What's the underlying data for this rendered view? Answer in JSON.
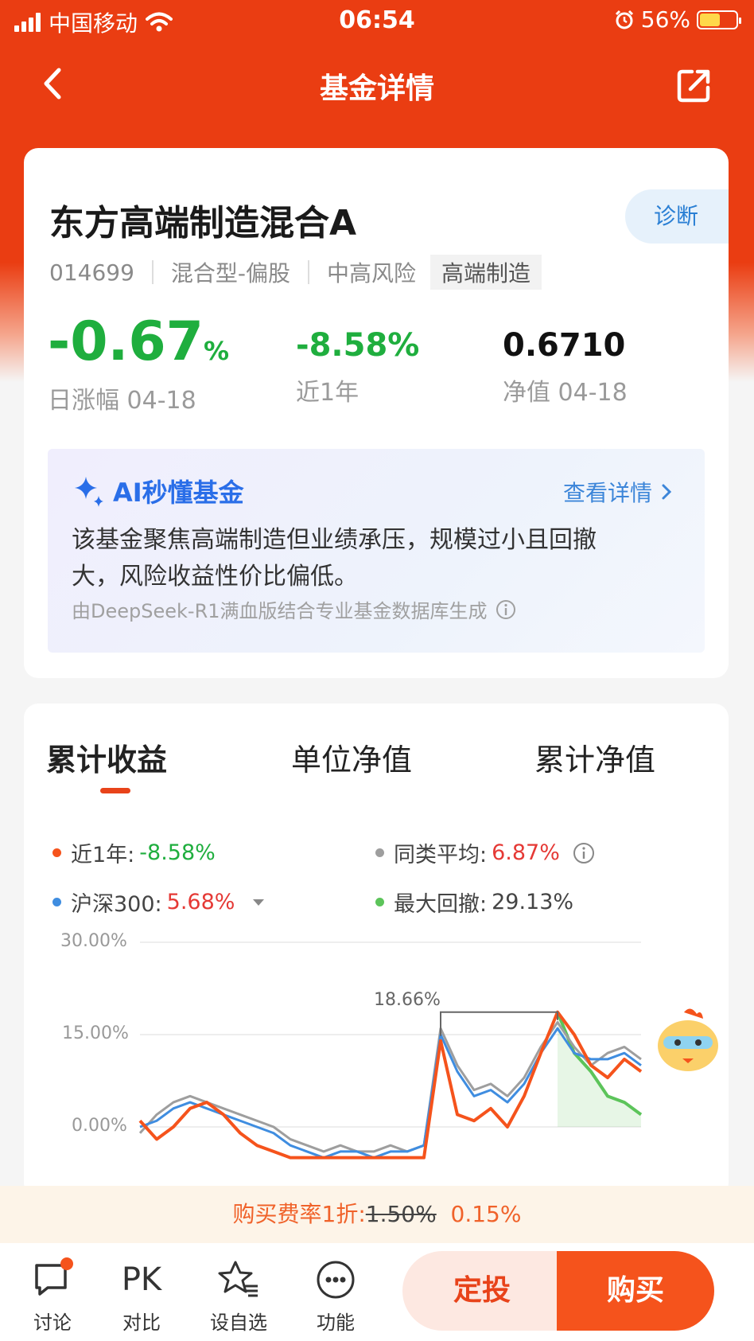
{
  "status": {
    "carrier": "中国移动",
    "time": "06:54",
    "battery": "56%"
  },
  "nav": {
    "title": "基金详情"
  },
  "fund": {
    "name": "东方高端制造混合A",
    "diagnose": "诊断",
    "code": "014699",
    "type": "混合型-偏股",
    "risk": "中高风险",
    "theme": "高端制造"
  },
  "stats": {
    "daily_value": "-0.67",
    "daily_unit": "%",
    "daily_label": "日涨幅 04-18",
    "year_value": "-8.58%",
    "year_label": "近1年",
    "nav_value": "0.6710",
    "nav_label": "净值 04-18"
  },
  "ai": {
    "title": "AI秒懂基金",
    "more": "查看详情",
    "text": "该基金聚焦高端制造但业绩承压，规模过小且回撤大，风险收益性价比偏低。",
    "foot": "由DeepSeek-R1满血版结合专业基金数据库生成"
  },
  "tabs": [
    "累计收益",
    "单位净值",
    "累计净值"
  ],
  "legend": {
    "fund_label": "近1年:",
    "fund_value": "-8.58%",
    "avg_label": "同类平均:",
    "avg_value": "6.87%",
    "index_label": "沪深300:",
    "index_value": "5.68%",
    "dd_label": "最大回撤:",
    "dd_value": "29.13%"
  },
  "colors": {
    "fund": "#f5531c",
    "avg": "#9e9e9e",
    "index": "#3f8de0",
    "drawdown": "#5cc45a",
    "brand": "#ea3d12"
  },
  "chart_data": {
    "type": "line",
    "yticks": [
      "30.00%",
      "15.00%",
      "0.00%"
    ],
    "peak_label": "18.66%",
    "ylim": [
      -5,
      30
    ],
    "series": [
      {
        "name": "近1年",
        "values": [
          1,
          -2,
          0,
          3,
          4,
          2,
          -1,
          -3,
          -4,
          -5,
          -5,
          -5,
          -5,
          -5,
          -5,
          -5,
          -5,
          -5,
          14,
          2,
          1,
          3,
          0,
          5,
          12,
          18.66,
          15,
          10,
          8,
          11,
          9
        ]
      },
      {
        "name": "同类平均",
        "values": [
          -1,
          2,
          4,
          5,
          4,
          3,
          2,
          1,
          0,
          -2,
          -3,
          -4,
          -3,
          -4,
          -4,
          -3,
          -4,
          -3,
          16,
          10,
          6,
          7,
          5,
          8,
          13,
          17,
          13,
          10,
          12,
          13,
          11
        ]
      },
      {
        "name": "沪深300",
        "values": [
          0,
          1,
          3,
          4,
          3,
          2,
          1,
          0,
          -1,
          -3,
          -4,
          -5,
          -4,
          -4,
          -5,
          -4,
          -4,
          -3,
          15,
          9,
          5,
          6,
          4,
          7,
          12,
          16,
          12,
          11,
          11,
          12,
          10
        ]
      },
      {
        "name": "最大回撤",
        "values": [
          null,
          null,
          null,
          null,
          null,
          null,
          null,
          null,
          null,
          null,
          null,
          null,
          null,
          null,
          null,
          null,
          null,
          null,
          null,
          null,
          null,
          null,
          null,
          null,
          null,
          18.66,
          12,
          9,
          5,
          4,
          2
        ]
      }
    ]
  },
  "fee": {
    "prefix": "购买费率1折:",
    "original": "1.50%",
    "current": "0.15%"
  },
  "bottom": {
    "discuss": "讨论",
    "compare_icon": "PK",
    "compare": "对比",
    "watch": "设自选",
    "func": "功能",
    "dingtou": "定投",
    "buy": "购买"
  }
}
